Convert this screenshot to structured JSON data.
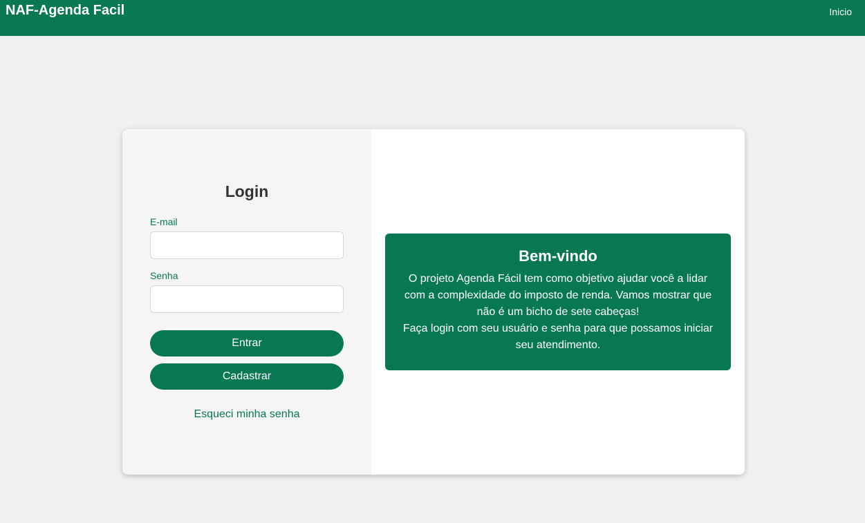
{
  "header": {
    "brand": "NAF-Agenda Facil",
    "nav_home": "Inicio"
  },
  "login": {
    "title": "Login",
    "email_label": "E-mail",
    "email_value": "",
    "password_label": "Senha",
    "password_value": "",
    "submit_label": "Entrar",
    "register_label": "Cadastrar",
    "forgot_label": "Esqueci minha senha"
  },
  "welcome": {
    "title": "Bem-vindo",
    "paragraph_1": "O projeto Agenda Fácil tem como objetivo ajudar você a lidar com a complexidade do imposto de renda. Vamos mostrar que não é um bicho de sete cabeças!",
    "paragraph_2": "Faça login com seu usuário e senha para que possamos iniciar seu atendimento."
  },
  "colors": {
    "primary": "#087853",
    "background": "#f0f0f0",
    "login_pane": "#f5f5f5"
  }
}
